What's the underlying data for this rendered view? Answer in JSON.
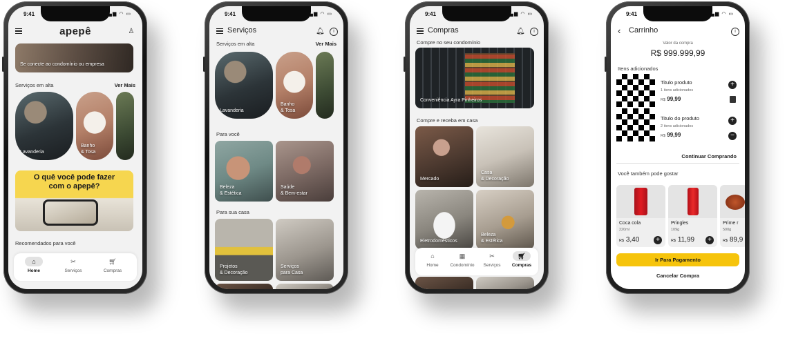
{
  "status_time": "9:41",
  "screen1": {
    "logo": "apepê",
    "banner": "Se conecte ao condomínio ou empresa",
    "section_services": "Serviços em alta",
    "see_more": "Ver Mais",
    "cards": [
      "Lavanderia",
      "Banho\n& Tosa"
    ],
    "promo": "O quê você pode fazer\ncom o apepê?",
    "recommended": "Recomendados para você",
    "nav": [
      "Home",
      "Serviços",
      "Compras"
    ]
  },
  "screen2": {
    "title": "Serviços",
    "section_trending": "Serviços em alta",
    "see_more": "Ver Mais",
    "trending_cards": [
      "Lavanderia",
      "Banho\n& Tosa"
    ],
    "section_for_you": "Para você",
    "for_you_cards": [
      "Beleza\n& Estética",
      "Saúde\n& Bem-estar"
    ],
    "section_home": "Para sua casa",
    "home_cards": [
      "Projetos\n& Decoração",
      "Serviços\npara Casa"
    ]
  },
  "screen3": {
    "title": "Compras",
    "section_condo": "Compre no seu condomínio",
    "condo_card": "Conveniência Ayra Pinheiros",
    "section_home": "Compre e receba em casa",
    "cards": [
      "Mercado",
      "Casa\n& Decoração",
      "Eletrodomésticos",
      "Beleza\n& Estética"
    ],
    "nav": [
      "Home",
      "Condomínio",
      "Serviços",
      "Compras"
    ]
  },
  "screen4": {
    "title": "Carrinho",
    "total_label": "Valor da compra",
    "total_value": "R$ 999.999,99",
    "items_label": "Itens adicionados",
    "items": [
      {
        "title": "Titulo produto",
        "qty": "1 itens adicionados",
        "currency": "R$",
        "price": "99,99"
      },
      {
        "title": "Titulo do produto",
        "qty": "2 itens adicionados",
        "currency": "R$",
        "price": "99,99"
      }
    ],
    "continue": "Continuar Comprando",
    "also_like": "Você também pode gostar",
    "products": [
      {
        "name": "Coca cola",
        "size": "220ml",
        "currency": "R$",
        "price": "3,40"
      },
      {
        "name": "Pringles",
        "size": "109g",
        "currency": "R$",
        "price": "11,99"
      },
      {
        "name": "Prime r",
        "size": "500g",
        "currency": "R$",
        "price": "89,9"
      }
    ],
    "pay_button": "Ir Para Pagamento",
    "cancel": "Cancelar Compra",
    "accent": "#f6c40c"
  }
}
